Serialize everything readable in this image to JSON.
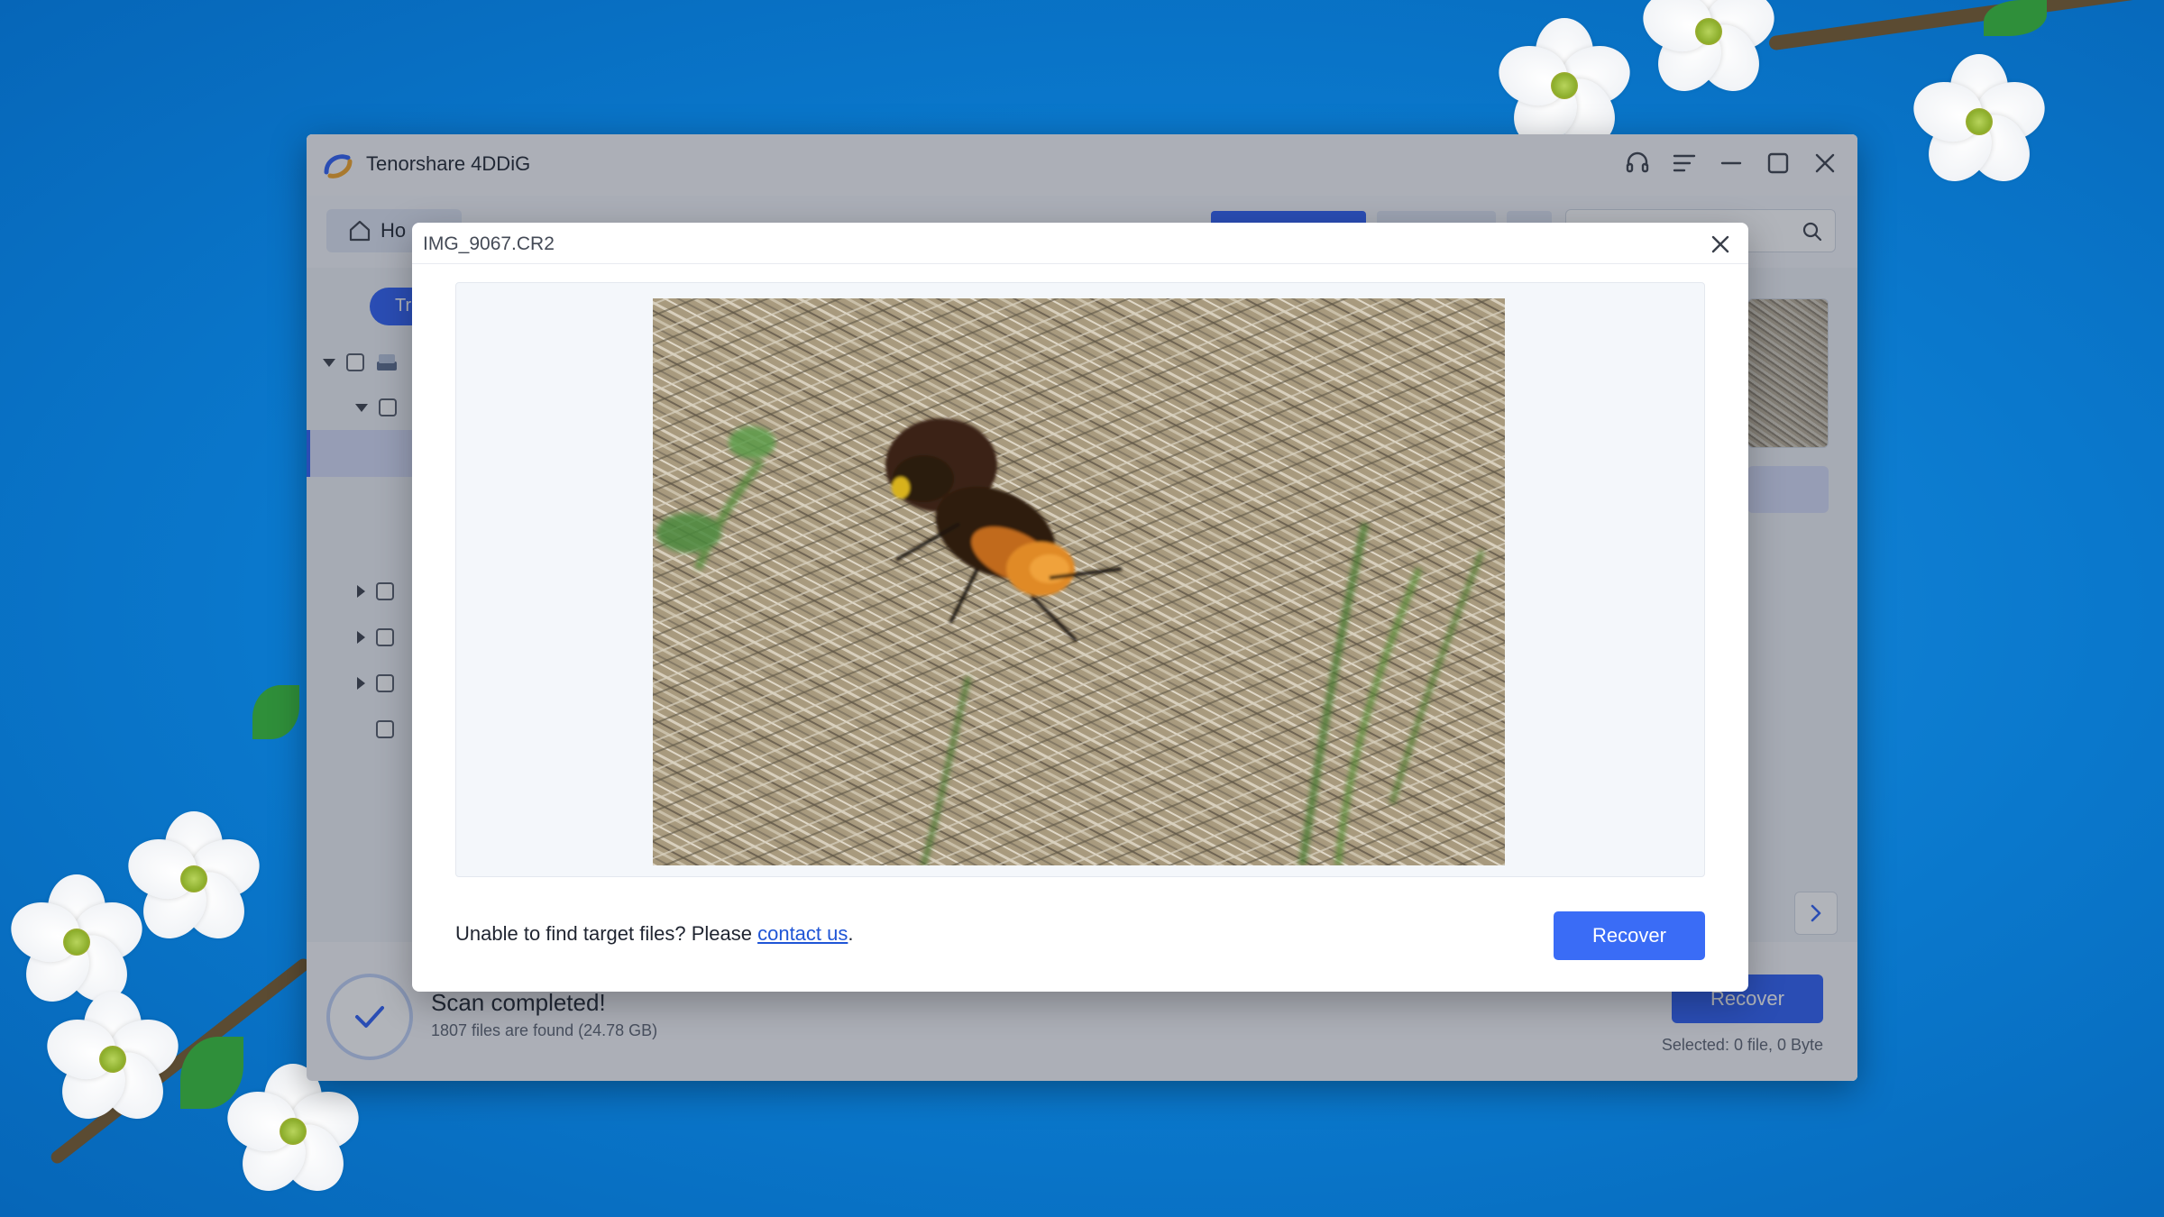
{
  "app": {
    "title": "Tenorshare 4DDiG",
    "brand_color": "#2c5ff6"
  },
  "titlebar": {
    "icons": [
      "headset-icon",
      "menu-icon",
      "minimize-icon",
      "maximize-icon",
      "close-icon"
    ]
  },
  "toolbar": {
    "home_label": "Ho",
    "tree_pill_label": "Tr"
  },
  "status": {
    "title": "Scan completed!",
    "subtitle": "1807 files are found (24.78 GB)",
    "recover_label": "Recover",
    "selected": "Selected: 0 file, 0 Byte"
  },
  "dialog": {
    "title": "IMG_9067.CR2",
    "footer_prefix": "Unable to find target files? Please ",
    "contact_link": "contact us",
    "footer_suffix": ".",
    "recover_label": "Recover"
  }
}
